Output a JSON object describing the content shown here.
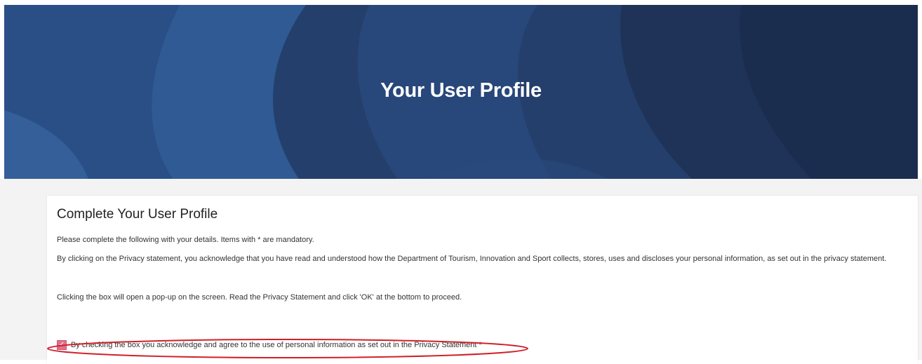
{
  "hero": {
    "title": "Your User Profile"
  },
  "profile_card": {
    "title": "Complete Your User Profile",
    "intro": "Please complete the following with your details. Items with * are mandatory.",
    "privacy_text": "By clicking on the Privacy statement, you acknowledge that you have read and understood how the Department of Tourism, Innovation and Sport collects, stores, uses and discloses your personal information, as set out in the privacy statement.",
    "popup_text": "Clicking the box will open a pop-up on the screen. Read the Privacy Statement and click 'OK' at the bottom to proceed.",
    "consent": {
      "label": "By checking the box you acknowledge and agree to the use of personal information as set out in the Privacy Statement *",
      "checked": true
    }
  },
  "colors": {
    "hero_dark": "#1e3258",
    "hero_light": "#2f5a94",
    "checkbox": "#e0708a",
    "annotation": "#d0202a"
  },
  "icons": {
    "checkbox": "check-icon"
  }
}
